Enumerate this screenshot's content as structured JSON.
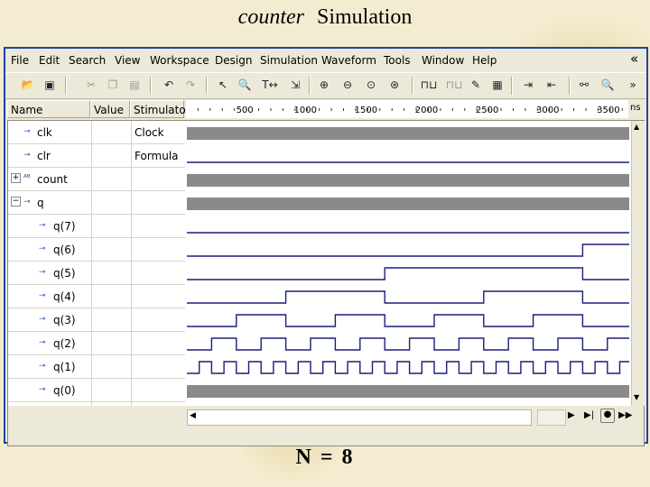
{
  "slide": {
    "title_italic": "counter",
    "title_rest": "Simulation",
    "caption": "N = 8"
  },
  "menu": [
    "File",
    "Edit",
    "Search",
    "View",
    "Workspace",
    "Design",
    "Simulation",
    "Waveform",
    "Tools",
    "Window",
    "Help"
  ],
  "menu_chevron": "«",
  "toolbar_icons": [
    "open-folder-icon",
    "save-icon",
    "cut-icon",
    "copy-icon",
    "paste-icon",
    "undo-icon",
    "redo-icon",
    "pointer-icon",
    "zoom-area-icon",
    "measure-icon",
    "select-waveform-icon",
    "zoom-in-icon",
    "zoom-out-icon",
    "zoom-fit-icon",
    "zoom-full-icon",
    "add-signal-icon",
    "delete-signal-icon",
    "stimulator-icon",
    "export-icon",
    "next-edge-icon",
    "prev-edge-icon",
    "find-icon",
    "find-next-icon"
  ],
  "columns": {
    "name": "Name",
    "value": "Value",
    "stimulator": "Stimulator",
    "unit": "ns"
  },
  "timeline_ticks": [
    "500",
    "1000",
    "1500",
    "2000",
    "2500",
    "3000",
    "3500"
  ],
  "signals": [
    {
      "name": "clk",
      "stimulator": "Clock",
      "icon": "input-arrow-icon"
    },
    {
      "name": "clr",
      "stimulator": "Formula",
      "icon": "input-arrow-icon"
    },
    {
      "name": "count",
      "stimulator": "",
      "icon": "bus-icon",
      "expand": "+"
    },
    {
      "name": "q",
      "stimulator": "",
      "icon": "output-arrow-icon",
      "expand": "−"
    },
    {
      "name": "q(7)",
      "stimulator": "",
      "icon": "output-arrow-icon"
    },
    {
      "name": "q(6)",
      "stimulator": "",
      "icon": "output-arrow-icon"
    },
    {
      "name": "q(5)",
      "stimulator": "",
      "icon": "output-arrow-icon"
    },
    {
      "name": "q(4)",
      "stimulator": "",
      "icon": "output-arrow-icon"
    },
    {
      "name": "q(3)",
      "stimulator": "",
      "icon": "output-arrow-icon"
    },
    {
      "name": "q(2)",
      "stimulator": "",
      "icon": "output-arrow-icon"
    },
    {
      "name": "q(1)",
      "stimulator": "",
      "icon": "output-arrow-icon"
    },
    {
      "name": "q(0)",
      "stimulator": "",
      "icon": "output-arrow-icon"
    }
  ],
  "colors": {
    "wave": "#1b1f7a",
    "bus": "#8a8a8a",
    "window_border": "#1d44a8"
  }
}
